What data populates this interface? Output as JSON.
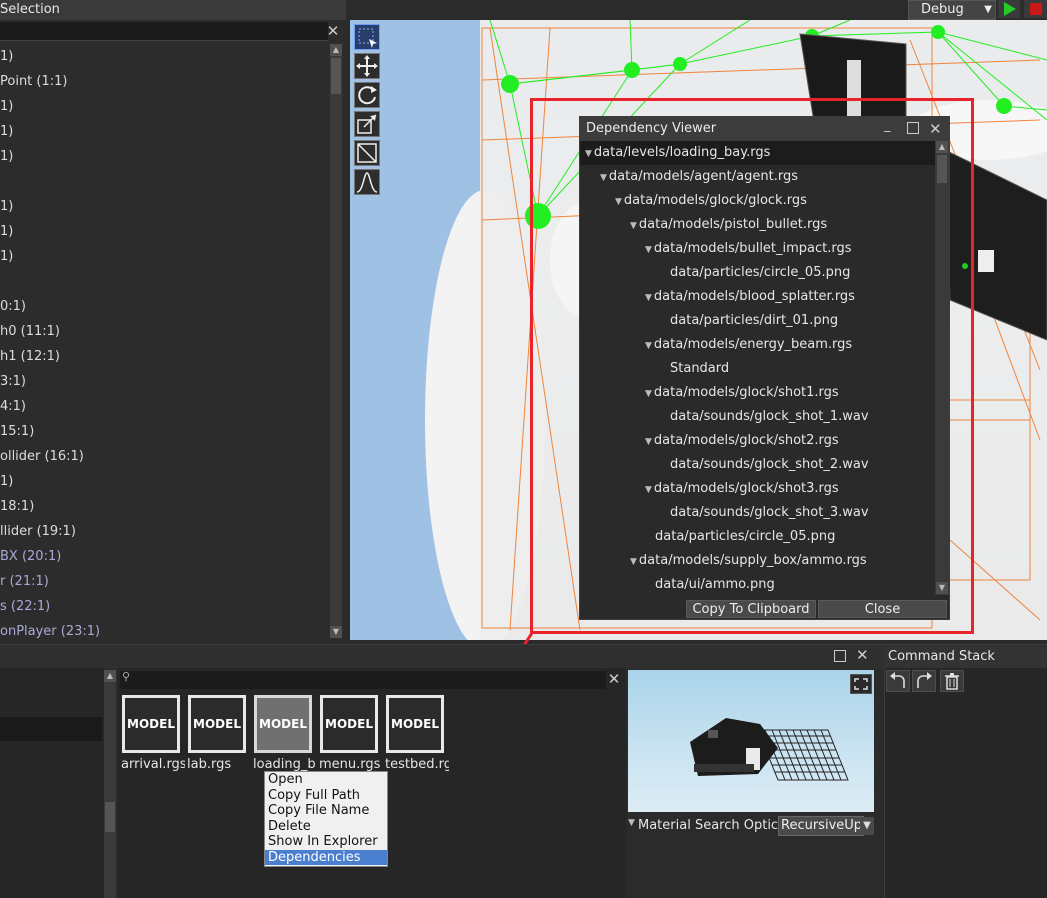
{
  "left_panel": {
    "title": "Selection",
    "items": [
      {
        "label": "1)",
        "dim": false
      },
      {
        "label": "Point (1:1)",
        "dim": false
      },
      {
        "label": "1)",
        "dim": false
      },
      {
        "label": "1)",
        "dim": false
      },
      {
        "label": "1)",
        "dim": false
      },
      {
        "label": "",
        "dim": false
      },
      {
        "label": "1)",
        "dim": false
      },
      {
        "label": "1)",
        "dim": false
      },
      {
        "label": "1)",
        "dim": false
      },
      {
        "label": "",
        "dim": false
      },
      {
        "label": "0:1)",
        "dim": false
      },
      {
        "label": "h0 (11:1)",
        "dim": false
      },
      {
        "label": "h1 (12:1)",
        "dim": false
      },
      {
        "label": "3:1)",
        "dim": false
      },
      {
        "label": "4:1)",
        "dim": false
      },
      {
        "label": "15:1)",
        "dim": false
      },
      {
        "label": "ollider (16:1)",
        "dim": false
      },
      {
        "label": "1)",
        "dim": false
      },
      {
        "label": "18:1)",
        "dim": false
      },
      {
        "label": "llider (19:1)",
        "dim": false
      },
      {
        "label": "BX (20:1)",
        "dim": true
      },
      {
        "label": "r (21:1)",
        "dim": true
      },
      {
        "label": "s (22:1)",
        "dim": true
      },
      {
        "label": "onPlayer (23:1)",
        "dim": true
      }
    ]
  },
  "toolbar": {
    "build_config": "Debug",
    "tools": [
      "select-tool-icon",
      "move-tool-icon",
      "rotate-tool-icon",
      "scale-tool-icon",
      "bounds-tool-icon",
      "curve-tool-icon"
    ]
  },
  "dependency_viewer": {
    "title": "Dependency Viewer",
    "rows": [
      {
        "label": "data/levels/loading_bay.rgs",
        "depth": 0,
        "expandable": true,
        "selected": true
      },
      {
        "label": "data/models/agent/agent.rgs",
        "depth": 1,
        "expandable": true
      },
      {
        "label": "data/models/glock/glock.rgs",
        "depth": 2,
        "expandable": true
      },
      {
        "label": "data/models/pistol_bullet.rgs",
        "depth": 3,
        "expandable": true
      },
      {
        "label": "data/models/bullet_impact.rgs",
        "depth": 4,
        "expandable": true
      },
      {
        "label": "data/particles/circle_05.png",
        "depth": 5,
        "expandable": false
      },
      {
        "label": "data/models/blood_splatter.rgs",
        "depth": 4,
        "expandable": true
      },
      {
        "label": "data/particles/dirt_01.png",
        "depth": 5,
        "expandable": false
      },
      {
        "label": "data/models/energy_beam.rgs",
        "depth": 4,
        "expandable": true
      },
      {
        "label": "Standard",
        "depth": 5,
        "expandable": false
      },
      {
        "label": "data/models/glock/shot1.rgs",
        "depth": 4,
        "expandable": true
      },
      {
        "label": "data/sounds/glock_shot_1.wav",
        "depth": 5,
        "expandable": false
      },
      {
        "label": "data/models/glock/shot2.rgs",
        "depth": 4,
        "expandable": true
      },
      {
        "label": "data/sounds/glock_shot_2.wav",
        "depth": 5,
        "expandable": false
      },
      {
        "label": "data/models/glock/shot3.rgs",
        "depth": 4,
        "expandable": true
      },
      {
        "label": "data/sounds/glock_shot_3.wav",
        "depth": 5,
        "expandable": false
      },
      {
        "label": "data/particles/circle_05.png",
        "depth": 4,
        "expandable": false
      },
      {
        "label": "data/models/supply_box/ammo.rgs",
        "depth": 3,
        "expandable": true
      },
      {
        "label": "data/ui/ammo.png",
        "depth": 4,
        "expandable": false
      }
    ],
    "copy_button": "Copy To Clipboard",
    "close_button": "Close"
  },
  "assets": {
    "tiles": [
      {
        "badge": "MODEL",
        "label": "arrival.rgs",
        "active": false
      },
      {
        "badge": "MODEL",
        "label": "lab.rgs",
        "active": false
      },
      {
        "badge": "MODEL",
        "label": "loading_b",
        "active": true
      },
      {
        "badge": "MODEL",
        "label": "menu.rgs",
        "active": false
      },
      {
        "badge": "MODEL",
        "label": "testbed.rg",
        "active": false
      }
    ]
  },
  "context_menu": {
    "items": [
      {
        "label": "Open",
        "highlighted": false
      },
      {
        "label": "Copy Full Path",
        "highlighted": false
      },
      {
        "label": "Copy File Name",
        "highlighted": false
      },
      {
        "label": "Delete",
        "highlighted": false
      },
      {
        "label": "Show In Explorer",
        "highlighted": false
      },
      {
        "label": "Dependencies",
        "highlighted": true
      }
    ]
  },
  "preview": {
    "material_search_label": "Material Search Optic",
    "material_search_value": "RecursiveUp"
  },
  "command_stack": {
    "title": "Command Stack"
  },
  "colors": {
    "annotation": "#e8242a",
    "menu_highlight": "#4a7ecf",
    "gizmo_green": "#22ee22",
    "wire_orange": "#f07a2a"
  }
}
